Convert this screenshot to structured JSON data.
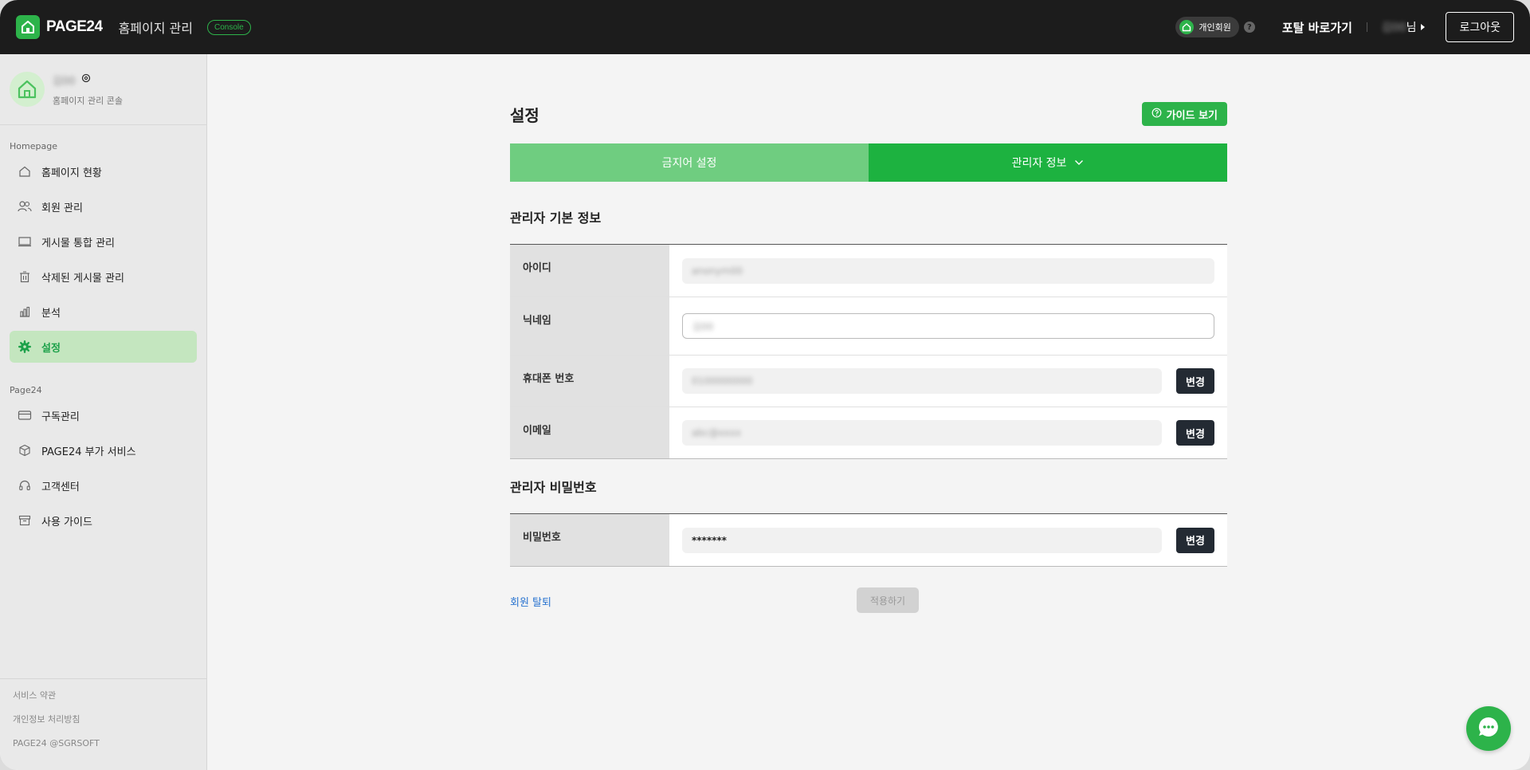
{
  "header": {
    "logo_text": "PAGE24",
    "app_title": "홈페이지 관리",
    "console_badge": "Console",
    "member_type": "개인회원",
    "help": "?",
    "portal_link": "포탈 바로가기",
    "user_name_masked": "김00",
    "user_suffix": "님",
    "logout": "로그아웃"
  },
  "sidebar": {
    "profile": {
      "name_masked": "김00",
      "subtitle": "홈페이지 관리 콘솔"
    },
    "sections": [
      {
        "title": "Homepage",
        "items": [
          {
            "label": "홈페이지 현황",
            "icon": "home-icon",
            "active": false
          },
          {
            "label": "회원 관리",
            "icon": "users-icon",
            "active": false
          },
          {
            "label": "게시물 통합 관리",
            "icon": "board-icon",
            "active": false
          },
          {
            "label": "삭제된 게시물 관리",
            "icon": "trash-icon",
            "active": false
          },
          {
            "label": "분석",
            "icon": "chart-icon",
            "active": false
          },
          {
            "label": "설정",
            "icon": "gear-icon",
            "active": true
          }
        ]
      },
      {
        "title": "Page24",
        "items": [
          {
            "label": "구독관리",
            "icon": "card-icon",
            "active": false
          },
          {
            "label": "PAGE24 부가 서비스",
            "icon": "box-icon",
            "active": false
          },
          {
            "label": "고객센터",
            "icon": "headset-icon",
            "active": false
          },
          {
            "label": "사용 가이드",
            "icon": "archive-icon",
            "active": false
          }
        ]
      }
    ],
    "footer": [
      "서비스 약관",
      "개인정보 처리방침",
      "PAGE24 @SGRSOFT"
    ]
  },
  "main": {
    "page_title": "설정",
    "guide_button": "가이드 보기",
    "tabs": [
      {
        "label": "금지어 설정"
      },
      {
        "label": "관리자 정보"
      }
    ],
    "basic_info": {
      "title": "관리자 기본 정보",
      "fields": [
        {
          "label": "아이디",
          "value": "anonym00"
        },
        {
          "label": "닉네임",
          "value": "김00"
        },
        {
          "label": "휴대폰 번호",
          "value": "0100000000",
          "button": "변경"
        },
        {
          "label": "이메일",
          "value": "abc@xxxx",
          "button": "변경"
        }
      ]
    },
    "password": {
      "title": "관리자 비밀번호",
      "label": "비밀번호",
      "value": "*******",
      "button": "변경"
    },
    "withdraw": "회원 탈퇴",
    "apply": "적용하기"
  },
  "colors": {
    "brand": "#2db34a",
    "tab_active": "#1db240",
    "tab_inactive": "#6fcd80",
    "topbar": "#1c1c1c",
    "link": "#2a74d0"
  }
}
